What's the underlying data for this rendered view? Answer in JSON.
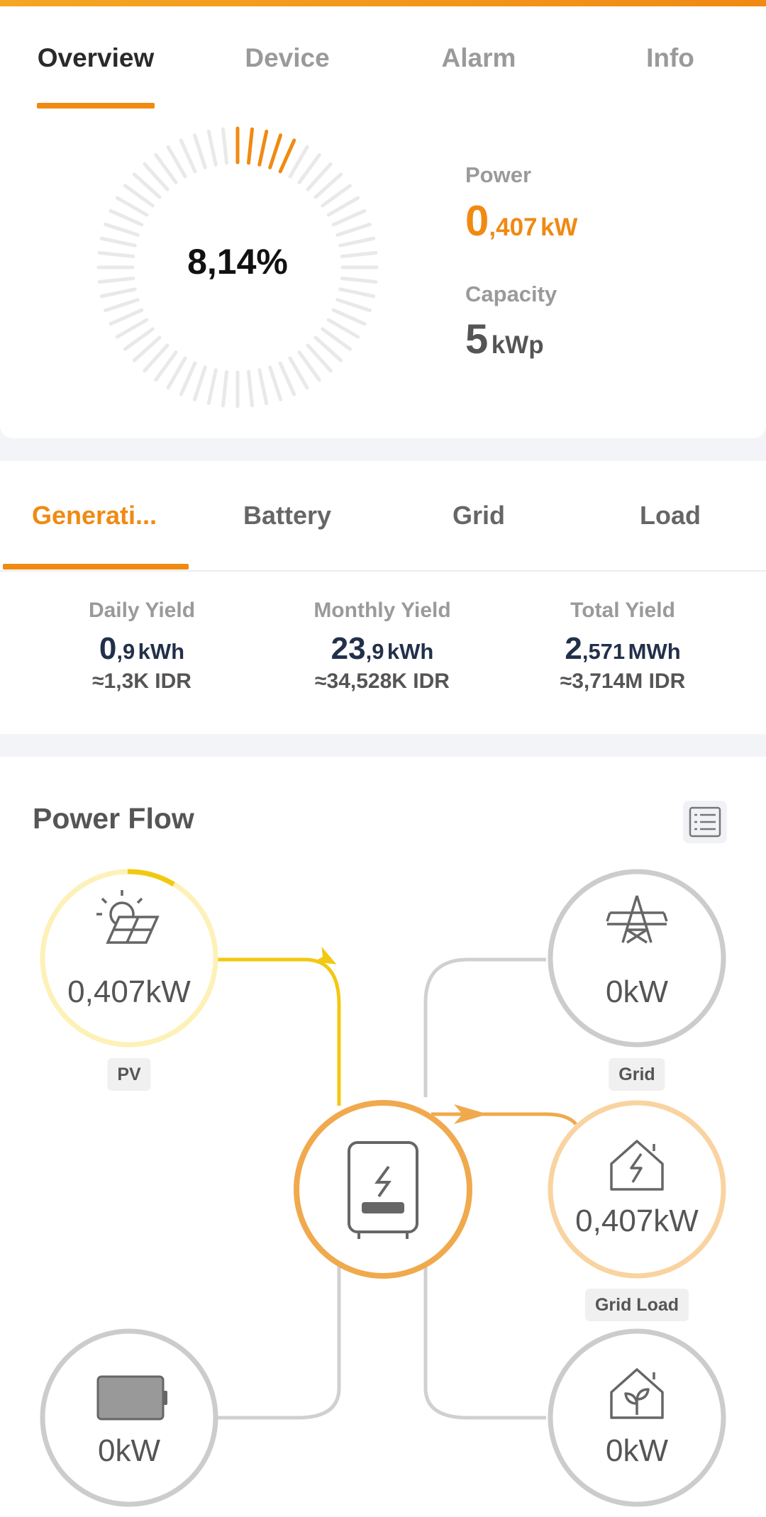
{
  "tabs": [
    "Overview",
    "Device",
    "Alarm",
    "Info"
  ],
  "overview": {
    "percent": "8,14%",
    "percent_value": 8.14,
    "power_label": "Power",
    "power_int": "0",
    "power_frac": ",407",
    "power_unit": "kW",
    "capacity_label": "Capacity",
    "capacity_int": "5",
    "capacity_unit": "kWp"
  },
  "tabs2": [
    "Generati...",
    "Battery",
    "Grid",
    "Load"
  ],
  "yields": [
    {
      "label": "Daily Yield",
      "int": "0",
      "frac": ",9",
      "unit": "kWh",
      "idr": "≈1,3K IDR"
    },
    {
      "label": "Monthly Yield",
      "int": "23",
      "frac": ",9",
      "unit": "kWh",
      "idr": "≈34,528K IDR"
    },
    {
      "label": "Total Yield",
      "int": "2",
      "frac": ",571",
      "unit": "MWh",
      "idr": "≈3,714M IDR"
    }
  ],
  "power_flow": {
    "title": "Power Flow",
    "pv": {
      "value": "0,407kW",
      "label": "PV"
    },
    "grid": {
      "value": "0kW",
      "label": "Grid"
    },
    "grid_load": {
      "value": "0,407kW",
      "label": "Grid Load"
    },
    "battery": {
      "value": "0kW"
    },
    "load": {
      "value": "0kW"
    }
  },
  "colors": {
    "accent": "#f08a12",
    "solar": "#f2c811",
    "inverter": "#f0a94c",
    "line": "#d0d0d0"
  },
  "icons": [
    "list-icon",
    "solar-panel-icon",
    "power-tower-icon",
    "inverter-icon",
    "house-lightning-icon",
    "battery-icon",
    "house-leaf-icon"
  ]
}
